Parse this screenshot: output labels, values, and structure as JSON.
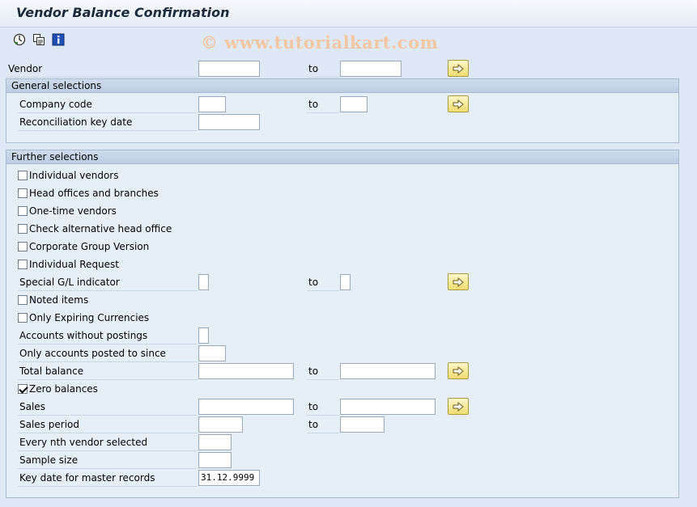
{
  "title": "Vendor Balance Confirmation",
  "watermark": "© www.tutorialkart.com",
  "toolbar": {
    "execute_icon": "execute-icon",
    "variants_icon": "variants-icon",
    "info_icon": "info-icon"
  },
  "to_label": "to",
  "vendor": {
    "label": "Vendor",
    "from": "",
    "to": ""
  },
  "general": {
    "title": "General selections",
    "company_code": {
      "label": "Company code",
      "from": "",
      "to": ""
    },
    "recon_key_date": {
      "label": "Reconciliation key date",
      "value": ""
    }
  },
  "further": {
    "title": "Further selections",
    "individual_vendors": {
      "label": "Individual vendors",
      "checked": false
    },
    "head_offices": {
      "label": "Head offices and branches",
      "checked": false
    },
    "one_time_vendors": {
      "label": "One-time vendors",
      "checked": false
    },
    "check_alt_head": {
      "label": "Check alternative head office",
      "checked": false
    },
    "corporate_group": {
      "label": "Corporate Group Version",
      "checked": false
    },
    "individual_request": {
      "label": "Individual Request",
      "checked": false
    },
    "special_gl": {
      "label": "Special G/L indicator",
      "from": "",
      "to": ""
    },
    "noted_items": {
      "label": "Noted items",
      "checked": false
    },
    "only_expiring": {
      "label": "Only Expiring Currencies",
      "checked": false
    },
    "accounts_without_postings": {
      "label": "Accounts without postings",
      "value": ""
    },
    "only_posted_since": {
      "label": "Only accounts posted to since",
      "value": ""
    },
    "total_balance": {
      "label": "Total balance",
      "from": "",
      "to": ""
    },
    "zero_balances": {
      "label": "Zero balances",
      "checked": true
    },
    "sales": {
      "label": "Sales",
      "from": "",
      "to": ""
    },
    "sales_period": {
      "label": "Sales period",
      "from": "",
      "to": ""
    },
    "every_nth": {
      "label": "Every nth vendor selected",
      "value": ""
    },
    "sample_size": {
      "label": "Sample size",
      "value": ""
    },
    "key_date_master": {
      "label": "Key date for master records",
      "value": "31.12.9999"
    }
  }
}
